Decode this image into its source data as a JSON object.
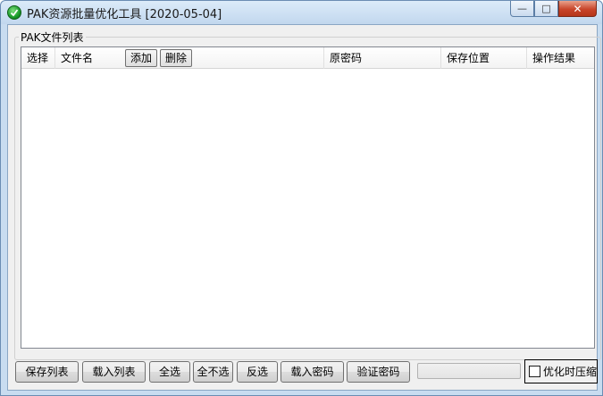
{
  "window": {
    "title": "PAK资源批量优化工具 [2020-05-04]",
    "caption": {
      "minimize": "—",
      "maximize": "□",
      "close": "✕"
    }
  },
  "group": {
    "label": "PAK文件列表"
  },
  "list": {
    "columns": [
      {
        "label": "选择"
      },
      {
        "label": "文件名"
      },
      {
        "label": "原密码"
      },
      {
        "label": "保存位置"
      },
      {
        "label": "操作结果"
      }
    ],
    "header_buttons": {
      "add": "添加",
      "delete": "删除"
    },
    "rows": []
  },
  "toolbar": {
    "save_list": "保存列表",
    "load_list": "载入列表",
    "select_all": "全选",
    "select_none": "全不选",
    "invert": "反选",
    "load_password": "载入密码",
    "verify_password": "验证密码",
    "progress": 0,
    "compress_label": "优化时压缩",
    "compress_checked": false
  },
  "colors": {
    "window_frame": "#c8dcf0",
    "client_bg": "#f0f0f0",
    "close_button": "#c8452a"
  },
  "icons": {
    "app": "green-circle-check-icon"
  }
}
